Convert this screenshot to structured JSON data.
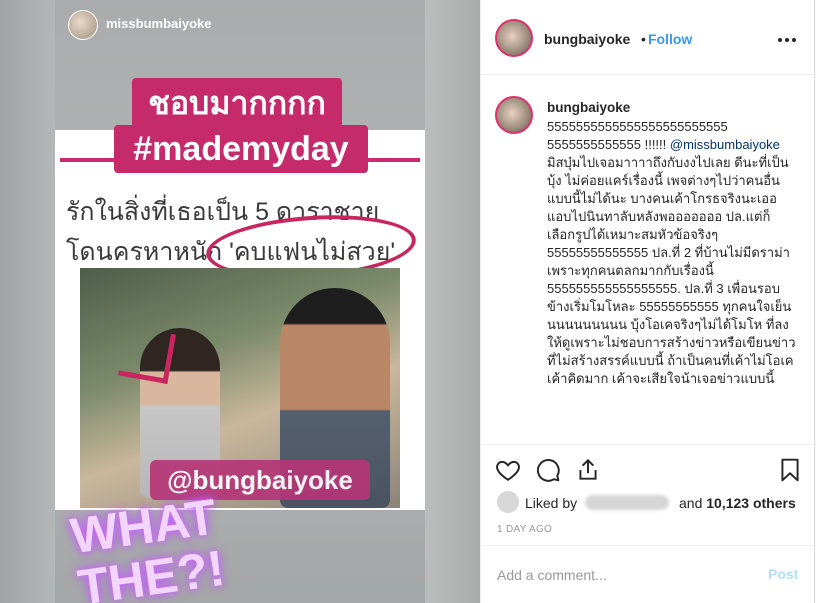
{
  "colors": {
    "link": "#3897f0",
    "mention": "#003569",
    "ring": "#e1306c",
    "accent_pink": "#c52a6a",
    "muted": "#999999",
    "post_disabled": "#b2dffc"
  },
  "story": {
    "username": "missbumbaiyoke",
    "sticker_line1": "ชอบมากกกก",
    "sticker_line2": "#mademyday",
    "text_line1": "รักในสิ่งที่เธอเป็น 5 ดาราชาย",
    "text_line2": "โดนครหาหนัก 'คบแฟนไม่สวย'",
    "handle_tag": "@bungbaiyoke",
    "what_line1": "WHAT",
    "what_line2": "THE?!"
  },
  "header": {
    "username": "bungbaiyoke",
    "separator": "•",
    "follow_label": "Follow",
    "more_icon": "more-horizontal-icon"
  },
  "caption": {
    "username": "bungbaiyoke",
    "line_numbers": "5555555555555555555555555 5555555555555 !!!!!! ",
    "mention": "@missbumbaiyoke",
    "body": " มิสบุ๋มไปเจอมาาาาถึงกับงงไปเลย ดีนะที่เป็นบุ้ง ไม่ค่อยแคร์เรื่องนี้ เพจต่างๆไปว่าคนอื่นแบบนี้ไม่ได้นะ บางคนเค้าโกรธจริงนะเออ แอบไปนินทาลับหลังพอออออออ ปล.แต่ก็เลือกรูปได้เหมาะสมหัวข้อจริงๆ 55555555555555 ปล.ที่ 2 ที่บ้านไม่มีดราม่า เพราะทุกคนตลกมากกับเรื่องนี้ 555555555555555555. ปล.ที่ 3 เพื่อนรอบข้างเริ่มโมโหละ 55555555555 ทุกคนใจเย็น นนนนนนนนน บุ้งโอเคจริงๆไม่ได้โมโห ที่ลงให้ดูเพราะไม่ชอบการสร้างข่าวหรือเขียนข่าวที่ไม่สร้างสรรค์แบบนี้ ถ้าเป็นคนที่เค้าไม่โอเค เค้าคิดมาก เค้าจะเสียใจน้าเจอข่าวแบบนี้"
  },
  "actions": {
    "icons": [
      "heart-icon",
      "comment-icon",
      "share-icon",
      "bookmark-icon"
    ],
    "liked_by_label": "Liked by",
    "and_label": "and",
    "others_count": "10,123 others",
    "timestamp": "1 DAY AGO"
  },
  "comment": {
    "placeholder": "Add a comment...",
    "post_label": "Post"
  }
}
